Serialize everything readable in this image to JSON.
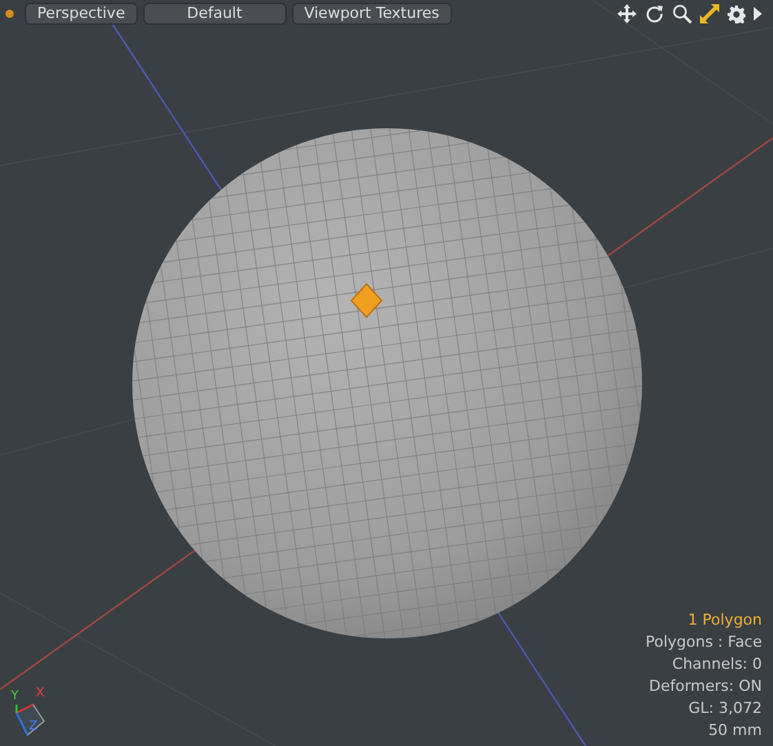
{
  "toolbar": {
    "buttons": [
      {
        "label": "Perspective"
      },
      {
        "label": "Default"
      },
      {
        "label": "Viewport Textures"
      }
    ],
    "icons": [
      {
        "kind": "move"
      },
      {
        "kind": "rotate"
      },
      {
        "kind": "zoom"
      },
      {
        "kind": "fit",
        "active": true
      },
      {
        "kind": "settings"
      },
      {
        "kind": "more"
      }
    ]
  },
  "gizmo": {
    "axes": [
      "X",
      "Y",
      "Z"
    ]
  },
  "info": {
    "selection": "1 Polygon",
    "lines": [
      "Polygons : Face",
      "Channels: 0",
      "Deformers: ON",
      "GL: 3,072",
      "50 mm"
    ]
  }
}
